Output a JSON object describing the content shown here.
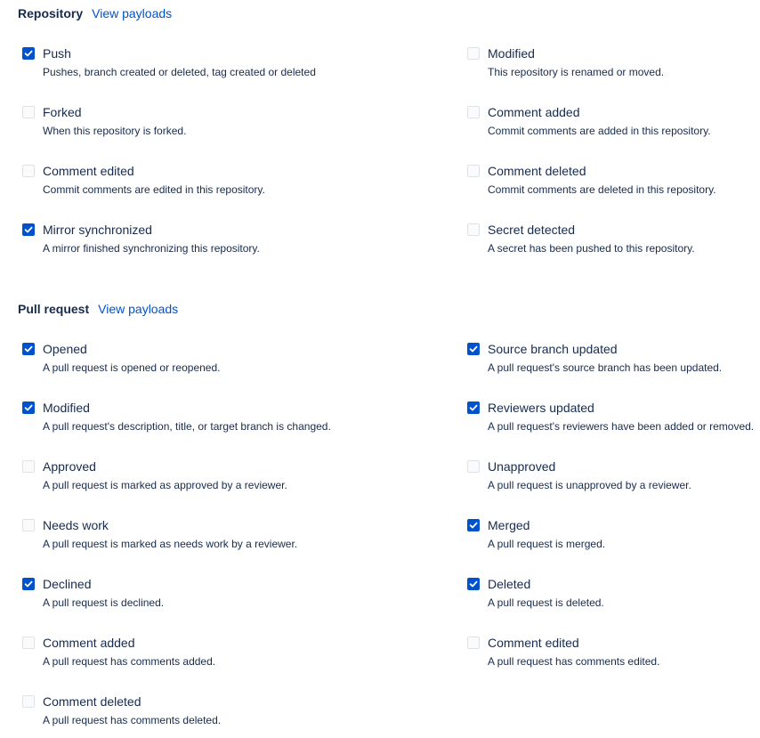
{
  "repository": {
    "title": "Repository",
    "view_payloads": "View payloads",
    "events": [
      {
        "label": "Push",
        "desc": "Pushes, branch created or deleted, tag created or deleted",
        "checked": true
      },
      {
        "label": "Modified",
        "desc": "This repository is renamed or moved.",
        "checked": false
      },
      {
        "label": "Forked",
        "desc": "When this repository is forked.",
        "checked": false
      },
      {
        "label": "Comment added",
        "desc": "Commit comments are added in this repository.",
        "checked": false
      },
      {
        "label": "Comment edited",
        "desc": "Commit comments are edited in this repository.",
        "checked": false
      },
      {
        "label": "Comment deleted",
        "desc": "Commit comments are deleted in this repository.",
        "checked": false
      },
      {
        "label": "Mirror synchronized",
        "desc": "A mirror finished synchronizing this repository.",
        "checked": true
      },
      {
        "label": "Secret detected",
        "desc": "A secret has been pushed to this repository.",
        "checked": false
      }
    ]
  },
  "pull_request": {
    "title": "Pull request",
    "view_payloads": "View payloads",
    "events": [
      {
        "label": "Opened",
        "desc": "A pull request is opened or reopened.",
        "checked": true
      },
      {
        "label": "Source branch updated",
        "desc": "A pull request's source branch has been updated.",
        "checked": true
      },
      {
        "label": "Modified",
        "desc": "A pull request's description, title, or target branch is changed.",
        "checked": true
      },
      {
        "label": "Reviewers updated",
        "desc": "A pull request's reviewers have been added or removed.",
        "checked": true
      },
      {
        "label": "Approved",
        "desc": "A pull request is marked as approved by a reviewer.",
        "checked": false
      },
      {
        "label": "Unapproved",
        "desc": "A pull request is unapproved by a reviewer.",
        "checked": false
      },
      {
        "label": "Needs work",
        "desc": "A pull request is marked as needs work by a reviewer.",
        "checked": false
      },
      {
        "label": "Merged",
        "desc": "A pull request is merged.",
        "checked": true
      },
      {
        "label": "Declined",
        "desc": "A pull request is declined.",
        "checked": true
      },
      {
        "label": "Deleted",
        "desc": "A pull request is deleted.",
        "checked": true
      },
      {
        "label": "Comment added",
        "desc": "A pull request has comments added.",
        "checked": false
      },
      {
        "label": "Comment edited",
        "desc": "A pull request has comments edited.",
        "checked": false
      },
      {
        "label": "Comment deleted",
        "desc": "A pull request has comments deleted.",
        "checked": false
      }
    ]
  },
  "colors": {
    "accent": "#0052cc",
    "text": "#172b4d",
    "checkbox_border": "#dfe1e6"
  }
}
